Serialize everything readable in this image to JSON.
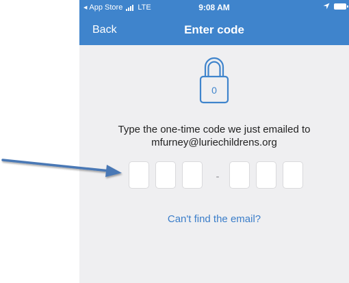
{
  "status_bar": {
    "carrier_back": "App Store",
    "network": "LTE",
    "time": "9:08 AM"
  },
  "nav": {
    "back_label": "Back",
    "title": "Enter code"
  },
  "lock": {
    "digit": "0"
  },
  "prompt": {
    "line1": "Type the one-time code we just emailed to",
    "line2": "mfurney@luriechildrens.org"
  },
  "code": {
    "separator": "-",
    "digits": [
      "",
      "",
      "",
      "",
      "",
      ""
    ]
  },
  "help_link": "Can't find the email?",
  "colors": {
    "header": "#3f84cc",
    "background": "#efeff1",
    "link": "#3a7dc9",
    "arrow": "#4a78b5"
  },
  "icons": [
    "back-triangle-icon",
    "signal-bars-icon",
    "location-arrow-icon",
    "battery-icon",
    "lock-icon",
    "arrow-annotation-icon"
  ]
}
